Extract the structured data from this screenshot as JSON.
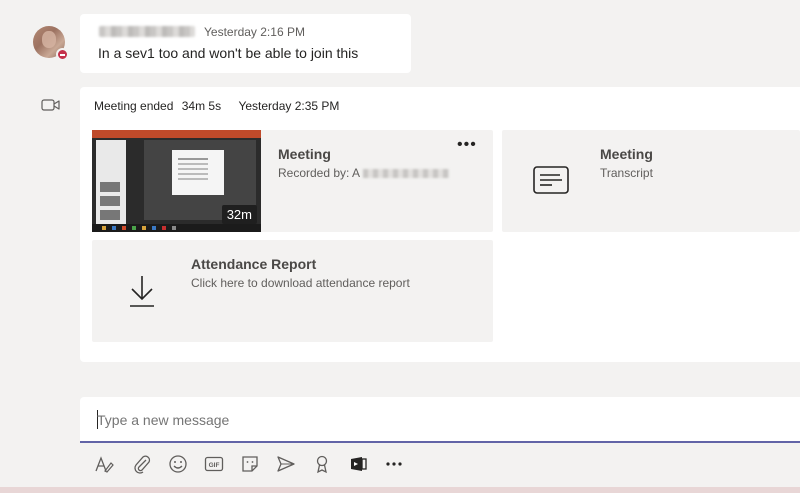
{
  "message": {
    "time": "Yesterday 2:16 PM",
    "text": "In a sev1 too and won't be able to join this"
  },
  "meeting": {
    "ended_label": "Meeting ended",
    "duration": "34m 5s",
    "time": "Yesterday 2:35 PM",
    "recording": {
      "title": "Meeting",
      "recorded_by_label": "Recorded by:",
      "recorded_by_visible": "A",
      "duration_badge": "32m"
    },
    "transcript": {
      "title": "Meeting",
      "subtitle": "Transcript"
    },
    "attendance": {
      "title": "Attendance Report",
      "subtitle": "Click here to download attendance report"
    }
  },
  "compose": {
    "placeholder": "Type a new message"
  },
  "toolbar": {
    "icons": [
      "format-icon",
      "attach-icon",
      "emoji-icon",
      "gif-icon",
      "sticker-icon",
      "meet-now-icon",
      "praise-icon",
      "stream-icon",
      "more-options-icon"
    ],
    "gif_label": "GIF"
  },
  "colors": {
    "accent": "#6264a7",
    "presence_busy": "#c4314b",
    "background": "#f3f2f1"
  }
}
